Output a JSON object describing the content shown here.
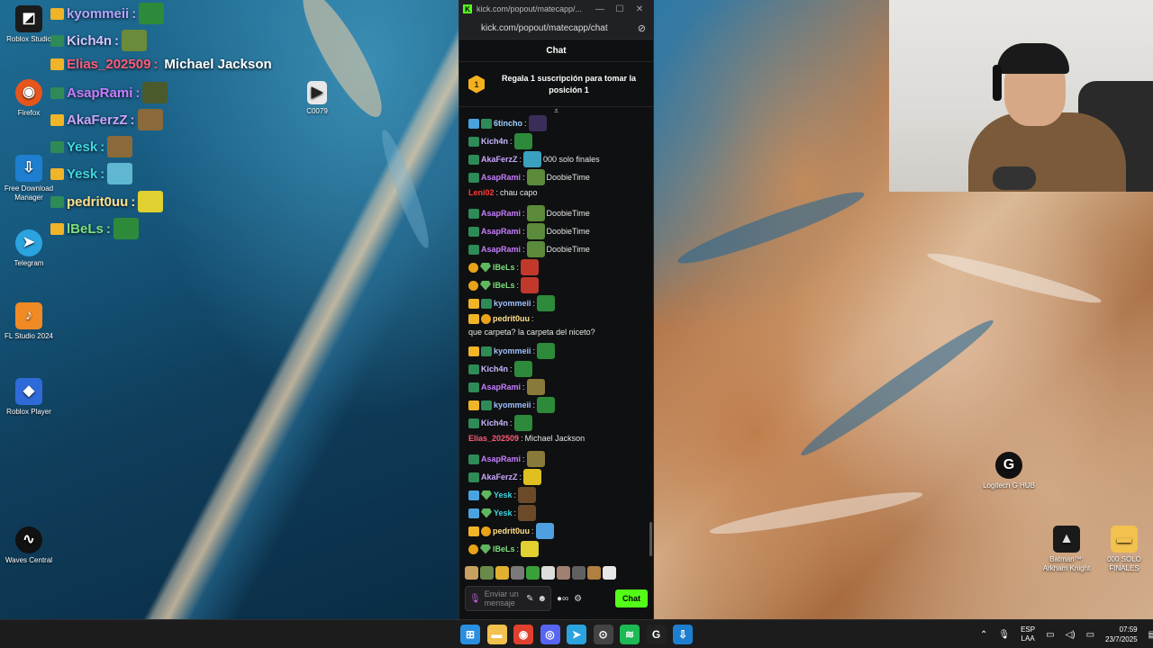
{
  "desktop": {
    "icons": [
      {
        "label": "Roblox Studio",
        "glyph": "◩",
        "color": "#1b1b1b",
        "icon": "roblox-studio-icon"
      },
      {
        "label": "Firefox",
        "glyph": "◉",
        "color": "#e6551b",
        "icon": "firefox-icon"
      },
      {
        "label": "Free Download Manager",
        "glyph": "⇩",
        "color": "#1e7fd1",
        "icon": "fdm-icon"
      },
      {
        "label": "Telegram",
        "glyph": "➤",
        "color": "#2aa3df",
        "icon": "telegram-icon"
      },
      {
        "label": "FL Studio 2024",
        "glyph": "♪",
        "color": "#f08a24",
        "icon": "fl-studio-icon"
      },
      {
        "label": "Roblox Player",
        "glyph": "◆",
        "color": "#2e6bd9",
        "icon": "roblox-player-icon"
      },
      {
        "label": "Waves Central",
        "glyph": "∿",
        "color": "#111111",
        "icon": "waves-icon"
      },
      {
        "label": "C0079",
        "glyph": "▶",
        "color": "#e8e8e8",
        "icon": "video-file-icon"
      },
      {
        "label": "Logitech G HUB",
        "glyph": "G",
        "color": "#111111",
        "icon": "logitech-icon"
      },
      {
        "label": "Batman™: Arkham Knight",
        "glyph": "▲",
        "color": "#1a1a1a",
        "icon": "batman-icon"
      },
      {
        "label": "000 SOLO FINALES",
        "glyph": "▬",
        "color": "#f2c14e",
        "icon": "folder-icon"
      }
    ]
  },
  "overlay": {
    "lines": [
      {
        "user": "kyommeii",
        "color": "#b7a4ff",
        "text": ""
      },
      {
        "user": "Kich4n",
        "color": "#d4c4ff",
        "text": ""
      },
      {
        "user": "Elias_202509",
        "color": "#ff5c7a",
        "text": "Michael Jackson"
      },
      {
        "user": "AsapRami",
        "color": "#c77dff",
        "text": ""
      },
      {
        "user": "AkaFerzZ",
        "color": "#c9a6ff",
        "text": ""
      },
      {
        "user": "Yesk",
        "color": "#3fd6e0",
        "text": ""
      },
      {
        "user": "Yesk",
        "color": "#3fd6e0",
        "text": ""
      },
      {
        "user": "pedrit0uu",
        "color": "#ffe08a",
        "text": ""
      },
      {
        "user": "lBeLs",
        "color": "#7ee07e",
        "text": ""
      }
    ]
  },
  "window": {
    "title": "kick.com/popout/matecapp/...",
    "controls": {
      "minimize": "—",
      "maximize": "☐",
      "close": "✕"
    },
    "url": "kick.com/popout/matecapp/chat",
    "chat_header": "Chat",
    "pinned": {
      "rank": "1",
      "text": "Regala 1 suscripción para tomar la posición 1"
    },
    "collapse_glyph": "⩡"
  },
  "messages": [
    {
      "badges": [
        "vip",
        "sub"
      ],
      "user": "6tincho",
      "color": "#9fd0ff",
      "emote": "#3a2d5a",
      "text": ""
    },
    {
      "badges": [
        "sub"
      ],
      "user": "Kich4n",
      "color": "#c9b8ff",
      "emote": "#2d8a3a",
      "text": ""
    },
    {
      "badges": [
        "sub"
      ],
      "user": "AkaFerzZ",
      "color": "#c9a6ff",
      "emote": "#3aa0c0",
      "text": "000 solo finales"
    },
    {
      "badges": [
        "sub"
      ],
      "user": "AsapRami",
      "color": "#c77dff",
      "emote": "#5a8a3a",
      "text": "DoobieTime"
    },
    {
      "badges": [],
      "user": "Leni02",
      "color": "#ff3b3b",
      "emote": "",
      "text": "chau capo"
    },
    {
      "badges": [
        "sub"
      ],
      "user": "AsapRami",
      "color": "#c77dff",
      "emote": "#5a8a3a",
      "text": "DoobieTime"
    },
    {
      "badges": [
        "sub"
      ],
      "user": "AsapRami",
      "color": "#c77dff",
      "emote": "#5a8a3a",
      "text": "DoobieTime"
    },
    {
      "badges": [
        "sub"
      ],
      "user": "AsapRami",
      "color": "#c77dff",
      "emote": "#5a8a3a",
      "text": "DoobieTime"
    },
    {
      "badges": [
        "gift",
        "mod"
      ],
      "user": "lBeLs",
      "color": "#7ee07e",
      "emote": "#c0392b",
      "text": ""
    },
    {
      "badges": [
        "gift",
        "mod"
      ],
      "user": "lBeLs",
      "color": "#7ee07e",
      "emote": "#c0392b",
      "text": ""
    },
    {
      "badges": [
        "og",
        "sub"
      ],
      "user": "kyommeii",
      "color": "#9fc0ff",
      "emote": "#2d8a3a",
      "text": ""
    },
    {
      "badges": [
        "og",
        "gift"
      ],
      "user": "pedrit0uu",
      "color": "#ffe08a",
      "emote": "",
      "text": "que carpeta? la carpeta del niceto?"
    },
    {
      "badges": [
        "og",
        "sub"
      ],
      "user": "kyommeii",
      "color": "#9fc0ff",
      "emote": "#2d8a3a",
      "text": ""
    },
    {
      "badges": [
        "sub"
      ],
      "user": "Kich4n",
      "color": "#c9b8ff",
      "emote": "#2d8a3a",
      "text": ""
    },
    {
      "badges": [
        "sub"
      ],
      "user": "AsapRami",
      "color": "#c77dff",
      "emote": "#8a7a3a",
      "text": ""
    },
    {
      "badges": [
        "og",
        "sub"
      ],
      "user": "kyommeii",
      "color": "#9fc0ff",
      "emote": "#2d8a3a",
      "text": ""
    },
    {
      "badges": [
        "sub"
      ],
      "user": "Kich4n",
      "color": "#c9b8ff",
      "emote": "#2d8a3a",
      "text": ""
    },
    {
      "badges": [],
      "user": "Elias_202509",
      "color": "#ff5c7a",
      "emote": "",
      "text": "Michael Jackson"
    },
    {
      "badges": [
        "sub"
      ],
      "user": "AsapRami",
      "color": "#c77dff",
      "emote": "#8a7a3a",
      "text": ""
    },
    {
      "badges": [
        "sub"
      ],
      "user": "AkaFerzZ",
      "color": "#c9a6ff",
      "emote": "#e0c020",
      "text": ""
    },
    {
      "badges": [
        "vip",
        "mod"
      ],
      "user": "Yesk",
      "color": "#3fd6e0",
      "emote": "#6b4a2a",
      "text": ""
    },
    {
      "badges": [
        "vip",
        "mod"
      ],
      "user": "Yesk",
      "color": "#3fd6e0",
      "emote": "#6b4a2a",
      "text": ""
    },
    {
      "badges": [
        "og",
        "gift"
      ],
      "user": "pedrit0uu",
      "color": "#ffe08a",
      "emote": "#4fa0e0",
      "text": ""
    },
    {
      "badges": [
        "gift",
        "mod"
      ],
      "user": "lBeLs",
      "color": "#7ee07e",
      "emote": "#e0d030",
      "text": ""
    }
  ],
  "emote_bar": [
    "#c8a060",
    "#6a8a4a",
    "#e0b030",
    "#7a7a7a",
    "#3aa03a",
    "#dddddd",
    "#a08070",
    "#606060",
    "#b08040",
    "#e8e8e8"
  ],
  "composer": {
    "mic_icon": "🎙",
    "placeholder": "Enviar un mensaje",
    "send_label": "Chat"
  },
  "taskbar": {
    "apps": [
      {
        "glyph": "⊞",
        "color": "#2b8fe0",
        "icon": "start-icon"
      },
      {
        "glyph": "▬",
        "color": "#f2c14e",
        "icon": "file-explorer-icon"
      },
      {
        "glyph": "◉",
        "color": "#e0402e",
        "icon": "chrome-icon"
      },
      {
        "glyph": "◎",
        "color": "#5865f2",
        "icon": "discord-icon"
      },
      {
        "glyph": "➤",
        "color": "#2aa3df",
        "icon": "telegram-icon"
      },
      {
        "glyph": "⊙",
        "color": "#444444",
        "icon": "obs-icon"
      },
      {
        "glyph": "≋",
        "color": "#1db954",
        "icon": "spotify-icon"
      },
      {
        "glyph": "G",
        "color": "#222222",
        "icon": "logitech-icon"
      },
      {
        "glyph": "⇩",
        "color": "#1e7fd1",
        "icon": "fdm-icon"
      }
    ],
    "language_top": "ESP",
    "language_bottom": "LAA",
    "time": "07:59",
    "date": "23/7/2025"
  }
}
